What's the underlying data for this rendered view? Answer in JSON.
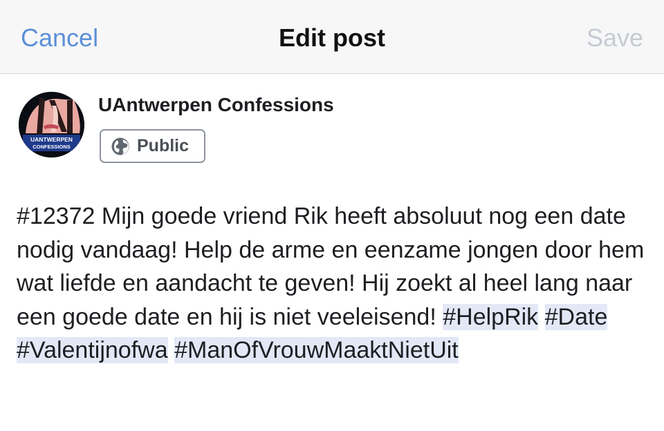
{
  "nav": {
    "cancel_label": "Cancel",
    "title": "Edit post",
    "save_label": "Save"
  },
  "page": {
    "name": "UAntwerpen Confessions",
    "avatar_line1": "UANTWERPEN",
    "avatar_line2": "CONFESSIONS"
  },
  "audience": {
    "icon": "globe-icon",
    "label": "Public"
  },
  "post": {
    "plain_text": "#12372 Mijn goede vriend Rik heeft absoluut nog een date nodig vandaag! Help de arme en eenzame jongen door hem wat liefde en aandacht te geven! Hij zoekt al heel lang naar een goede date en hij is niet veeleisend! ",
    "hashtags": [
      "#HelpRik",
      "#Date",
      "#Valentijnofwa",
      "#ManOfVrouwMaaktNietUit"
    ]
  },
  "colors": {
    "accent": "#5b8fd9",
    "save_disabled": "#c6cbd2",
    "hashtag_highlight": "#e3e8f7",
    "nav_background": "#f7f7f8"
  }
}
